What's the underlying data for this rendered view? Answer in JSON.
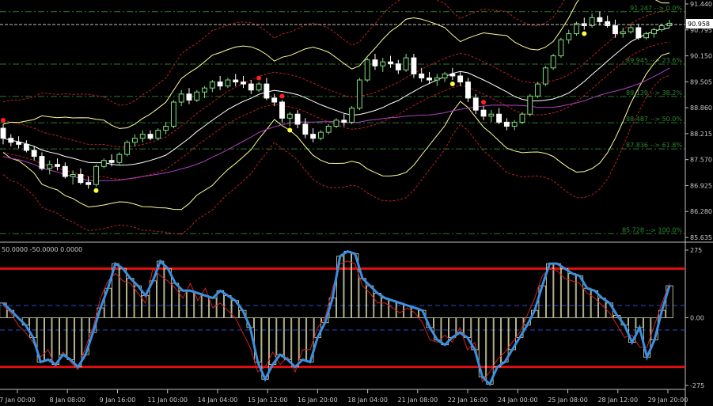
{
  "window": {
    "background": "#000000",
    "axis_color": "#c0c0c0",
    "grid_color": "#1a1a1a"
  },
  "chart_data": [
    {
      "type": "candlestick",
      "panel": "price",
      "price_axis_ticks": [
        "91.440",
        "90.795",
        "90.150",
        "89.505",
        "88.860",
        "88.215",
        "87.570",
        "86.925",
        "86.280",
        "85.635"
      ],
      "current_price": "90.958",
      "ylim": [
        85.635,
        91.44
      ],
      "candles": [
        [
          88.35,
          88.45,
          87.95,
          88.1
        ],
        [
          88.1,
          88.2,
          87.9,
          88.0
        ],
        [
          88.0,
          88.15,
          87.85,
          87.95
        ],
        [
          87.95,
          88.05,
          87.75,
          87.8
        ],
        [
          87.8,
          87.9,
          87.55,
          87.65
        ],
        [
          87.65,
          87.75,
          87.3,
          87.35
        ],
        [
          87.35,
          87.55,
          87.2,
          87.45
        ],
        [
          87.45,
          87.6,
          87.3,
          87.4
        ],
        [
          87.4,
          87.5,
          87.1,
          87.15
        ],
        [
          87.15,
          87.3,
          86.95,
          87.2
        ],
        [
          87.2,
          87.35,
          86.95,
          87.0
        ],
        [
          87.0,
          87.15,
          86.85,
          86.95
        ],
        [
          86.95,
          87.45,
          86.9,
          87.4
        ],
        [
          87.4,
          87.6,
          87.35,
          87.55
        ],
        [
          87.55,
          87.7,
          87.4,
          87.5
        ],
        [
          87.5,
          87.75,
          87.45,
          87.7
        ],
        [
          87.7,
          88.05,
          87.65,
          88.0
        ],
        [
          88.0,
          88.2,
          87.9,
          88.1
        ],
        [
          88.1,
          88.3,
          88.0,
          88.2
        ],
        [
          88.2,
          88.3,
          88.05,
          88.1
        ],
        [
          88.1,
          88.35,
          88.05,
          88.3
        ],
        [
          88.3,
          88.5,
          88.2,
          88.4
        ],
        [
          88.4,
          89.05,
          88.35,
          89.0
        ],
        [
          89.0,
          89.3,
          88.9,
          89.2
        ],
        [
          89.2,
          89.35,
          88.95,
          89.05
        ],
        [
          89.05,
          89.3,
          89.0,
          89.25
        ],
        [
          89.25,
          89.4,
          89.1,
          89.35
        ],
        [
          89.35,
          89.55,
          89.25,
          89.5
        ],
        [
          89.5,
          89.65,
          89.3,
          89.4
        ],
        [
          89.4,
          89.6,
          89.35,
          89.55
        ],
        [
          89.55,
          89.7,
          89.4,
          89.5
        ],
        [
          89.5,
          89.65,
          89.35,
          89.45
        ],
        [
          89.45,
          89.55,
          89.2,
          89.3
        ],
        [
          89.3,
          89.5,
          89.25,
          89.45
        ],
        [
          89.45,
          89.6,
          89.05,
          89.1
        ],
        [
          89.1,
          89.2,
          88.9,
          89.0
        ],
        [
          89.0,
          89.05,
          88.5,
          88.6
        ],
        [
          88.6,
          88.75,
          88.4,
          88.7
        ],
        [
          88.7,
          88.8,
          88.35,
          88.45
        ],
        [
          88.45,
          88.6,
          88.1,
          88.2
        ],
        [
          88.2,
          88.35,
          88.0,
          88.1
        ],
        [
          88.1,
          88.3,
          88.05,
          88.25
        ],
        [
          88.25,
          88.45,
          88.2,
          88.4
        ],
        [
          88.4,
          88.6,
          88.35,
          88.55
        ],
        [
          88.55,
          88.7,
          88.4,
          88.5
        ],
        [
          88.5,
          88.9,
          88.45,
          88.85
        ],
        [
          88.85,
          89.6,
          88.8,
          89.55
        ],
        [
          89.55,
          90.1,
          89.5,
          90.05
        ],
        [
          90.05,
          90.2,
          89.8,
          89.9
        ],
        [
          89.9,
          90.1,
          89.75,
          90.0
        ],
        [
          90.0,
          90.15,
          89.85,
          89.95
        ],
        [
          89.95,
          90.05,
          89.7,
          89.8
        ],
        [
          89.8,
          90.2,
          89.75,
          90.1
        ],
        [
          90.1,
          90.2,
          89.6,
          89.7
        ],
        [
          89.7,
          89.85,
          89.5,
          89.6
        ],
        [
          89.6,
          89.75,
          89.45,
          89.55
        ],
        [
          89.55,
          89.7,
          89.4,
          89.6
        ],
        [
          89.6,
          89.75,
          89.5,
          89.7
        ],
        [
          89.7,
          89.85,
          89.55,
          89.65
        ],
        [
          89.65,
          89.75,
          89.4,
          89.5
        ],
        [
          89.5,
          89.6,
          89.0,
          89.1
        ],
        [
          89.1,
          89.2,
          88.7,
          88.8
        ],
        [
          88.8,
          88.9,
          88.55,
          88.65
        ],
        [
          88.65,
          88.8,
          88.5,
          88.7
        ],
        [
          88.7,
          88.85,
          88.45,
          88.5
        ],
        [
          88.5,
          88.6,
          88.3,
          88.4
        ],
        [
          88.4,
          88.55,
          88.3,
          88.5
        ],
        [
          88.5,
          88.75,
          88.45,
          88.7
        ],
        [
          88.7,
          89.2,
          88.65,
          89.15
        ],
        [
          89.15,
          89.5,
          89.1,
          89.45
        ],
        [
          89.45,
          89.9,
          89.4,
          89.85
        ],
        [
          89.85,
          90.2,
          89.8,
          90.15
        ],
        [
          90.15,
          90.6,
          90.1,
          90.55
        ],
        [
          90.55,
          90.8,
          90.45,
          90.7
        ],
        [
          90.7,
          91.0,
          90.65,
          90.95
        ],
        [
          90.95,
          91.1,
          90.8,
          90.9
        ],
        [
          90.9,
          91.2,
          90.85,
          91.1
        ],
        [
          91.1,
          91.25,
          90.9,
          91.0
        ],
        [
          91.0,
          91.15,
          90.85,
          90.9
        ],
        [
          90.9,
          91.05,
          90.6,
          90.7
        ],
        [
          90.7,
          90.85,
          90.6,
          90.75
        ],
        [
          90.75,
          90.95,
          90.7,
          90.85
        ],
        [
          90.85,
          90.95,
          90.55,
          90.6
        ],
        [
          90.6,
          90.75,
          90.55,
          90.7
        ],
        [
          90.7,
          90.85,
          90.6,
          90.8
        ],
        [
          90.8,
          90.95,
          90.75,
          90.9
        ],
        [
          90.9,
          91.05,
          90.85,
          90.96
        ]
      ],
      "fractal_up": [
        0,
        33,
        36,
        62,
        93
      ],
      "fractal_down": [
        12,
        37,
        58,
        75,
        94,
        96
      ],
      "fibonacci": [
        {
          "label": "91.247 --> 0.0%",
          "value": 91.247
        },
        {
          "label": "89.945 --> 23.6%",
          "value": 89.945
        },
        {
          "label": "89.139 --> 38.2%",
          "value": 89.139
        },
        {
          "label": "88.487 --> 50.0%",
          "value": 88.487
        },
        {
          "label": "87.836 --> 61.8%",
          "value": 87.836
        },
        {
          "label": "85.728 --> 100.0%",
          "value": 85.728
        }
      ],
      "colors": {
        "bull": "#7ee07e",
        "bear": "#ffffff",
        "fib": "#2e7a2e",
        "fib_text": "#2e8b2e",
        "envelope": "#b22222",
        "bb": "#ffff99",
        "ma_mid": "#ffffff",
        "ma_slow": "#b040c0",
        "fractal_up": "#ff2020",
        "fractal_down": "#ffff40"
      }
    },
    {
      "type": "oscillator",
      "panel": "cci",
      "header": "50.0000 -50.0000 0.0000",
      "axis_ticks": [
        "275",
        "0.00",
        "-275"
      ],
      "ylim": [
        -275,
        275
      ],
      "levels": [
        200,
        50,
        -50,
        -200
      ],
      "cci": [
        60,
        30,
        0,
        -30,
        -80,
        -180,
        -170,
        -190,
        -150,
        -170,
        -200,
        -150,
        -60,
        40,
        120,
        220,
        200,
        160,
        130,
        90,
        150,
        230,
        200,
        140,
        110,
        110,
        100,
        90,
        80,
        110,
        90,
        70,
        30,
        -40,
        -180,
        -250,
        -190,
        -150,
        -170,
        -200,
        -170,
        -180,
        -80,
        -20,
        80,
        250,
        270,
        260,
        160,
        130,
        100,
        80,
        70,
        60,
        50,
        40,
        30,
        -40,
        -90,
        -110,
        -80,
        -60,
        -80,
        -130,
        -240,
        -270,
        -200,
        -180,
        -130,
        -80,
        -30,
        30,
        130,
        220,
        220,
        200,
        180,
        170,
        120,
        110,
        80,
        60,
        10,
        -30,
        -100,
        -40,
        -160,
        -90,
        30,
        130
      ],
      "signal": [
        50,
        20,
        -30,
        -60,
        -100,
        -160,
        -130,
        -200,
        -140,
        -180,
        -210,
        -120,
        -40,
        80,
        150,
        180,
        150,
        140,
        100,
        60,
        200,
        170,
        150,
        120,
        80,
        140,
        70,
        120,
        40,
        60,
        30,
        0,
        -60,
        -120,
        -220,
        -200,
        -140,
        -190,
        -160,
        -220,
        -130,
        -130,
        -40,
        0,
        120,
        220,
        230,
        220,
        130,
        100,
        60,
        60,
        40,
        20,
        40,
        20,
        -20,
        -90,
        -100,
        -70,
        -100,
        -40,
        -130,
        -100,
        -260,
        -220,
        -170,
        -140,
        -100,
        -60,
        10,
        80,
        170,
        200,
        190,
        160,
        150,
        140,
        100,
        80,
        50,
        20,
        -30,
        -80,
        -70,
        -120,
        -120,
        -30,
        60,
        140
      ],
      "colors": {
        "cci": "#3a8fe0",
        "signal": "#d02020",
        "hist": "#e0e0b0",
        "level_outer": "#e01010",
        "level_inner": "#2a4ad0"
      }
    }
  ],
  "time_axis": [
    "7 Jan 00:00",
    "8 Jan 08:00",
    "9 Jan 16:00",
    "11 Jan 00:00",
    "14 Jan 04:00",
    "15 Jan 12:00",
    "16 Jan 20:00",
    "18 Jan 04:00",
    "21 Jan 08:00",
    "22 Jan 16:00",
    "24 Jan 00:00",
    "25 Jan 08:00",
    "28 Jan 12:00",
    "29 Jan 20:00"
  ]
}
